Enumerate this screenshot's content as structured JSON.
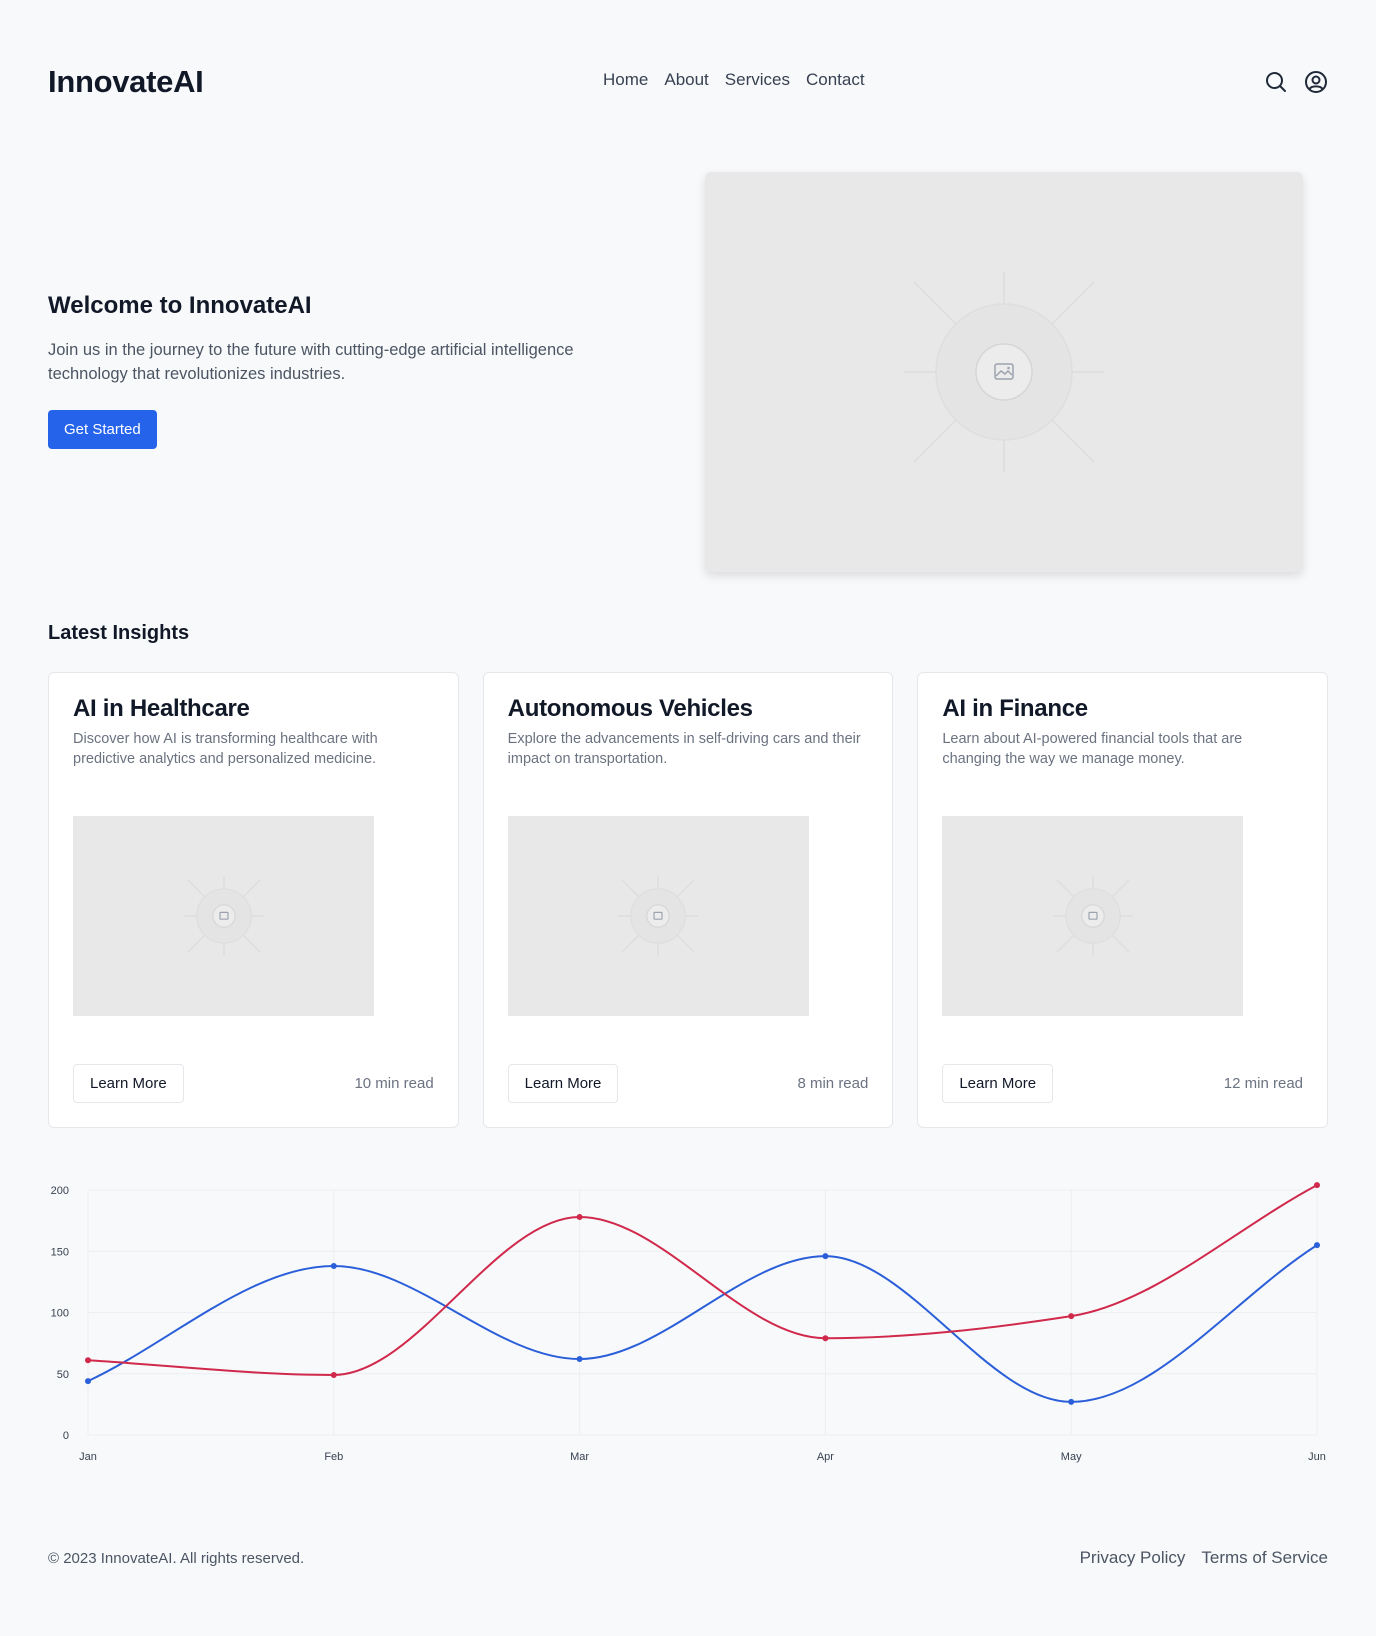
{
  "header": {
    "logo": "InnovateAI",
    "nav": [
      "Home",
      "About",
      "Services",
      "Contact"
    ],
    "icons": [
      "search-icon",
      "user-icon"
    ]
  },
  "hero": {
    "title": "Welcome to InnovateAI",
    "subtitle": "Join us in the journey to the future with cutting-edge artificial intelligence technology that revolutionizes industries.",
    "cta": "Get Started",
    "accent": "#2563eb"
  },
  "insights": {
    "title": "Latest Insights",
    "cards": [
      {
        "title": "AI in Healthcare",
        "desc": "Discover how AI is transforming healthcare with predictive analytics and personalized medicine.",
        "button": "Learn More",
        "read": "10 min read"
      },
      {
        "title": "Autonomous Vehicles",
        "desc": "Explore the advancements in self-driving cars and their impact on transportation.",
        "button": "Learn More",
        "read": "8 min read"
      },
      {
        "title": "AI in Finance",
        "desc": "Learn about AI-powered financial tools that are changing the way we manage money.",
        "button": "Learn More",
        "read": "12 min read"
      }
    ]
  },
  "chart_data": {
    "type": "line",
    "categories": [
      "Jan",
      "Feb",
      "Mar",
      "Apr",
      "May",
      "Jun"
    ],
    "series": [
      {
        "values": [
          44,
          138,
          62,
          146,
          27,
          155
        ],
        "color": "#2b5fd9"
      },
      {
        "values": [
          61,
          49,
          178,
          79,
          97,
          204
        ],
        "color": "#d0294b"
      }
    ],
    "yticks": [
      0,
      50,
      100,
      150,
      200
    ],
    "ylim": [
      0,
      200
    ],
    "grid": true
  },
  "footer": {
    "copyright": "© 2023 InnovateAI. All rights reserved.",
    "links": [
      "Privacy Policy",
      "Terms of Service"
    ]
  }
}
